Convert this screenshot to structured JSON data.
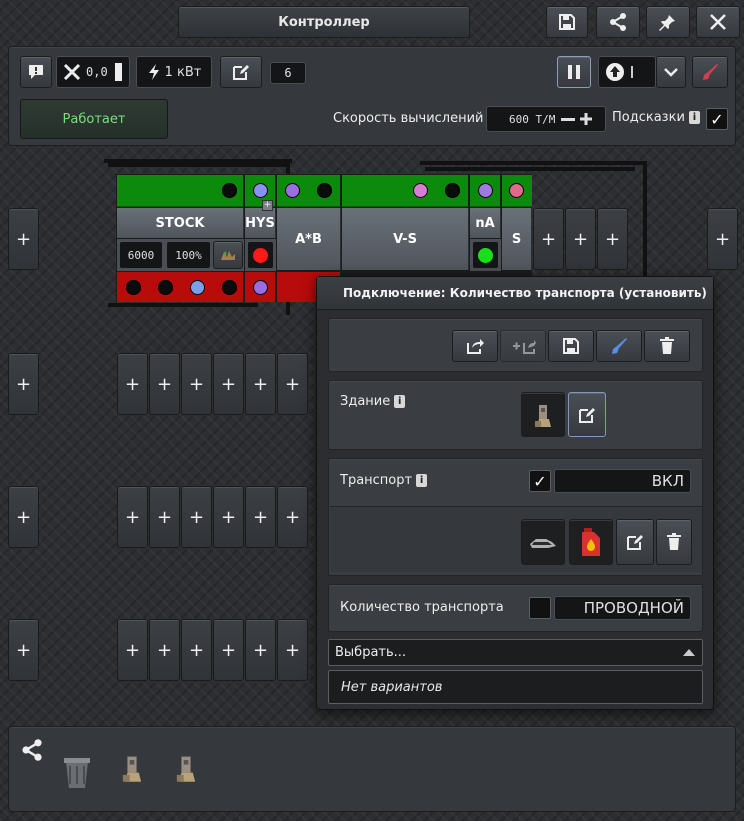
{
  "window": {
    "title": "Контроллер"
  },
  "toolbar": {
    "alert_icon": "alert-icon",
    "signal_value": "0,0",
    "power_value": "1 кВт",
    "edit_count": "6",
    "status_label": "Работает",
    "speed_label": "Скорость вычислений",
    "speed_value": "600 Т/М",
    "hints_label": "Подсказки",
    "hints_checked": true
  },
  "combinators": [
    {
      "label": "STOCK",
      "v1": "6000",
      "v2": "100%"
    },
    {
      "label": "HYS"
    },
    {
      "label": "A*B"
    },
    {
      "label": "V-S"
    },
    {
      "label": "nA"
    },
    {
      "label": "S"
    }
  ],
  "plus_label": "+",
  "panel": {
    "title": "Подключение: Количество транспорта (установить)",
    "building_label": "Здание",
    "transport_label": "Транспорт",
    "transport_value": "ВКЛ",
    "transport_checked": true,
    "count_label": "Количество транспорта",
    "count_value": "ПРОВОДНОЙ",
    "count_checked": false,
    "select_label": "Выбрать...",
    "no_options": "Нет вариантов"
  },
  "colors": {
    "green": "#0b8a0b",
    "red": "#b80b0b",
    "status_text": "#7be07b",
    "accent_red": "#d04050"
  }
}
